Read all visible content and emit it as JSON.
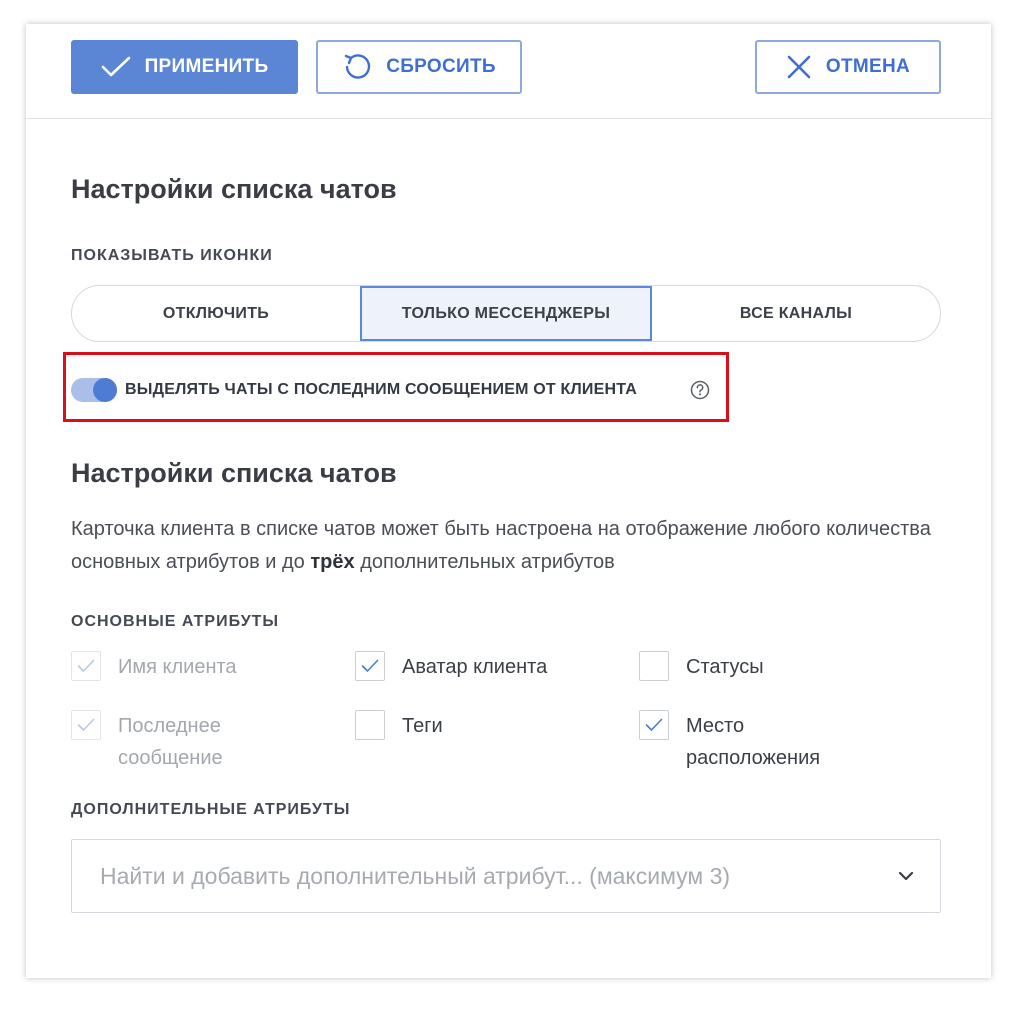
{
  "toolbar": {
    "apply_label": "ПРИМЕНИТЬ",
    "reset_label": "СБРОСИТЬ",
    "cancel_label": "ОТМЕНА"
  },
  "section1": {
    "title": "Настройки списка чатов",
    "icons_label": "ПОКАЗЫВАТЬ ИКОНКИ",
    "icon_options": [
      "ОТКЛЮЧИТЬ",
      "ТОЛЬКО МЕССЕНДЖЕРЫ",
      "ВСЕ КАНАЛЫ"
    ],
    "selected_option": "ТОЛЬКО МЕССЕНДЖЕРЫ",
    "toggle_label": "ВЫДЕЛЯТЬ ЧАТЫ С ПОСЛЕДНИМ СООБЩЕНИЕМ ОТ КЛИЕНТА",
    "toggle_on": true
  },
  "section2": {
    "title": "Настройки списка чатов",
    "description_part1": "Карточка клиента в списке чатов может быть настроена на отображение любого количества основных атрибутов и до ",
    "description_bold": "трёх",
    "description_part2": " дополнительных атрибутов",
    "main_attrs_label": "ОСНОВНЫЕ АТРИБУТЫ",
    "attributes": [
      {
        "label": "Имя клиента",
        "checked": true,
        "disabled": true
      },
      {
        "label": "Аватар клиента",
        "checked": true,
        "disabled": false
      },
      {
        "label": "Статусы",
        "checked": false,
        "disabled": false
      },
      {
        "label": "Последнее сообщение",
        "checked": true,
        "disabled": true
      },
      {
        "label": "Теги",
        "checked": false,
        "disabled": false
      },
      {
        "label": "Место расположения",
        "checked": true,
        "disabled": false
      }
    ],
    "extra_attrs_label": "ДОПОЛНИТЕЛЬНЫЕ АТРИБУТЫ",
    "extra_attrs_placeholder": "Найти и добавить дополнительный атрибут... (максимум 3)"
  },
  "colors": {
    "accent": "#5b86d6",
    "highlight": "#d9101b"
  }
}
